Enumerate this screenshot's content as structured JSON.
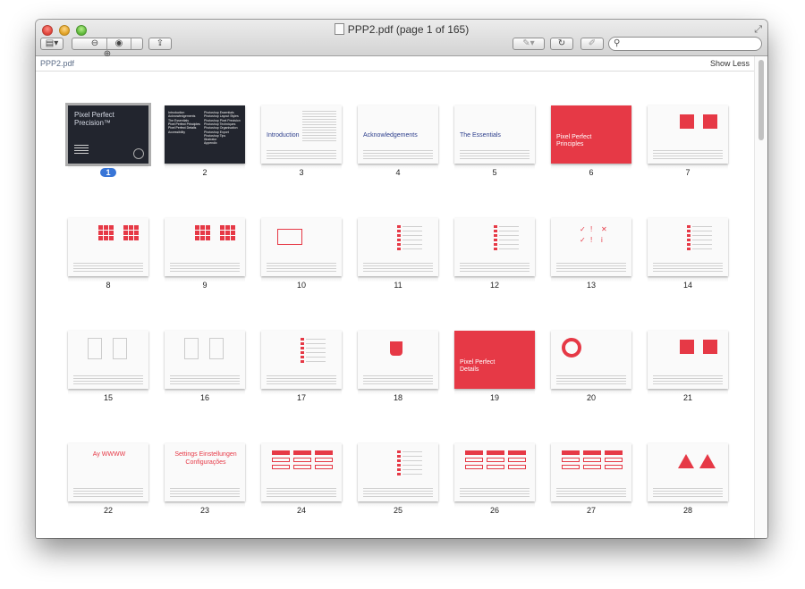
{
  "window": {
    "title": "PPP2.pdf (page 1 of 165)",
    "fullscreen_icon": "fullscreen-arrows-icon"
  },
  "toolbar": {
    "view_icon": "sidebar-view-icon",
    "zoom_out_icon": "zoom-out-icon",
    "actual_size_icon": "actual-size-icon",
    "zoom_in_icon": "zoom-in-icon",
    "share_icon": "share-icon",
    "annotate_icon": "pen-annotate-icon",
    "rotate_icon": "rotate-icon",
    "edit_icon": "edit-icon",
    "search_placeholder": ""
  },
  "header": {
    "doc_name": "PPP2.pdf",
    "show_less": "Show Less"
  },
  "pages": [
    {
      "num": "1",
      "title": "Pixel Perfect Precision™",
      "style": "dark",
      "selected": true
    },
    {
      "num": "2",
      "title": "",
      "style": "darkmenu"
    },
    {
      "num": "3",
      "title": "Introduction",
      "style": "light"
    },
    {
      "num": "4",
      "title": "Acknowledgements",
      "style": "light"
    },
    {
      "num": "5",
      "title": "The Essentials",
      "style": "light"
    },
    {
      "num": "6",
      "title": "Pixel Perfect Principles",
      "style": "red"
    },
    {
      "num": "7",
      "title": "",
      "style": "squares2"
    },
    {
      "num": "8",
      "title": "",
      "style": "grid"
    },
    {
      "num": "9",
      "title": "",
      "style": "grid"
    },
    {
      "num": "10",
      "title": "",
      "style": "light"
    },
    {
      "num": "11",
      "title": "",
      "style": "list"
    },
    {
      "num": "12",
      "title": "",
      "style": "list"
    },
    {
      "num": "13",
      "title": "",
      "style": "icons"
    },
    {
      "num": "14",
      "title": "",
      "style": "list"
    },
    {
      "num": "15",
      "title": "",
      "style": "light"
    },
    {
      "num": "16",
      "title": "",
      "style": "light"
    },
    {
      "num": "17",
      "title": "",
      "style": "list"
    },
    {
      "num": "18",
      "title": "",
      "style": "cup"
    },
    {
      "num": "19",
      "title": "Pixel Perfect Details",
      "style": "red"
    },
    {
      "num": "20",
      "title": "",
      "style": "ring"
    },
    {
      "num": "21",
      "title": "",
      "style": "squares2"
    },
    {
      "num": "22",
      "title": "Ay WWWW",
      "style": "text"
    },
    {
      "num": "23",
      "title": "Settings Einstellungen Configurações",
      "style": "text"
    },
    {
      "num": "24",
      "title": "",
      "style": "buttons"
    },
    {
      "num": "25",
      "title": "",
      "style": "list"
    },
    {
      "num": "26",
      "title": "",
      "style": "buttons"
    },
    {
      "num": "27",
      "title": "",
      "style": "buttons"
    },
    {
      "num": "28",
      "title": "",
      "style": "triangles"
    }
  ],
  "page2_menu": [
    "Introduction",
    "Acknowledgements",
    "The Essentials",
    "Pixel Perfect Principles",
    "Pixel Perfect Details",
    "Accessibility",
    "Photoshop Essentials",
    "Photoshop Layout Styles",
    "Photoshop Pixel Precision",
    "Photoshop Techniques",
    "Photoshop Organisation",
    "Photoshop Export",
    "Photoshop Tips",
    "Illustrator",
    "Appendix"
  ],
  "colors": {
    "accent_red": "#e63946",
    "selection_blue": "#3875d7",
    "dark_page": "#22252e"
  }
}
